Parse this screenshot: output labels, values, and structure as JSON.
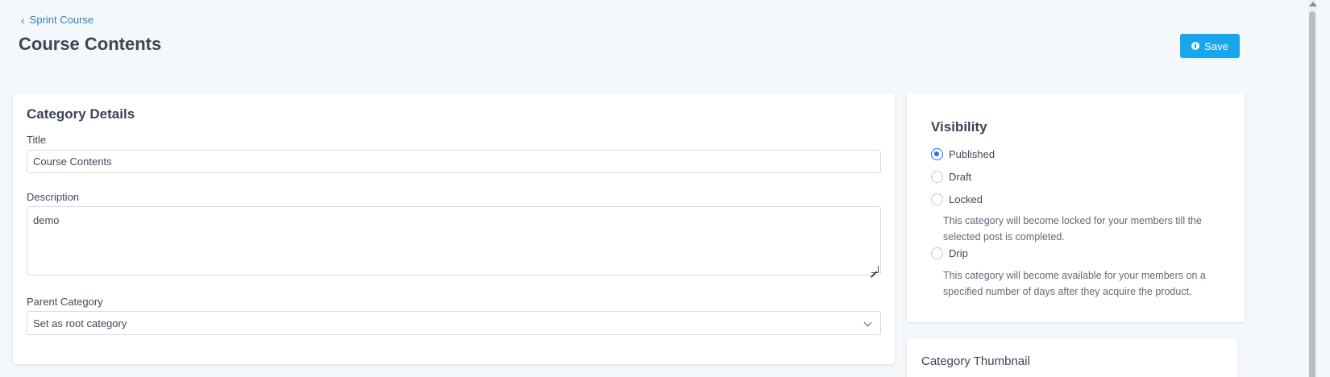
{
  "breadcrumb": {
    "label": "Sprint Course",
    "icon": "chevron-left-icon"
  },
  "header": {
    "title": "Course Contents",
    "save_label": "Save",
    "save_icon": "info-circle-icon",
    "accent": "#1aa6ec"
  },
  "details": {
    "heading": "Category Details",
    "title_label": "Title",
    "title_value": "Course Contents",
    "description_label": "Description",
    "description_value": "demo",
    "parent_label": "Parent Category",
    "parent_value": "Set as root category"
  },
  "visibility": {
    "heading": "Visibility",
    "options": [
      {
        "label": "Published",
        "checked": true
      },
      {
        "label": "Draft",
        "checked": false
      },
      {
        "label": "Locked",
        "checked": false,
        "help": "This category will become locked for your members till the selected post is completed."
      },
      {
        "label": "Drip",
        "checked": false,
        "help": "This category will become available for your members on a specified number of days after they acquire the product."
      }
    ]
  },
  "thumbnail": {
    "heading": "Category Thumbnail"
  }
}
